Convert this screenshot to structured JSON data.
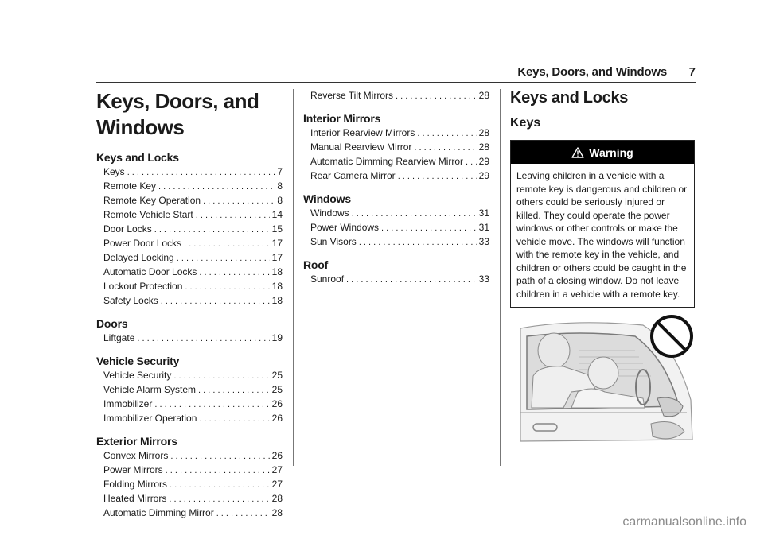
{
  "running_header": {
    "title": "Keys, Doors, and Windows",
    "page_number": "7"
  },
  "chapter": {
    "title_line1": "Keys, Doors, and",
    "title_line2": "Windows"
  },
  "toc_col1": [
    {
      "heading": "Keys and Locks",
      "items": [
        {
          "label": "Keys",
          "page": "7"
        },
        {
          "label": "Remote Key",
          "page": "8"
        },
        {
          "label": "Remote Key Operation",
          "page": "8"
        },
        {
          "label": "Remote Vehicle Start",
          "page": "14"
        },
        {
          "label": "Door Locks",
          "page": "15"
        },
        {
          "label": "Power Door Locks",
          "page": "17"
        },
        {
          "label": "Delayed Locking",
          "page": "17"
        },
        {
          "label": "Automatic Door Locks",
          "page": "18"
        },
        {
          "label": "Lockout Protection",
          "page": "18"
        },
        {
          "label": "Safety Locks",
          "page": "18"
        }
      ]
    },
    {
      "heading": "Doors",
      "items": [
        {
          "label": "Liftgate",
          "page": "19"
        }
      ]
    },
    {
      "heading": "Vehicle Security",
      "items": [
        {
          "label": "Vehicle Security",
          "page": "25"
        },
        {
          "label": "Vehicle Alarm System",
          "page": "25"
        },
        {
          "label": "Immobilizer",
          "page": "26"
        },
        {
          "label": "Immobilizer Operation",
          "page": "26"
        }
      ]
    },
    {
      "heading": "Exterior Mirrors",
      "items": [
        {
          "label": "Convex Mirrors",
          "page": "26"
        },
        {
          "label": "Power Mirrors",
          "page": "27"
        },
        {
          "label": "Folding Mirrors",
          "page": "27"
        },
        {
          "label": "Heated Mirrors",
          "page": "28"
        },
        {
          "label": "Automatic Dimming Mirror",
          "page": "28"
        }
      ]
    }
  ],
  "toc_col2_continued": [
    {
      "label": "Reverse Tilt Mirrors",
      "page": "28"
    }
  ],
  "toc_col2": [
    {
      "heading": "Interior Mirrors",
      "items": [
        {
          "label": "Interior Rearview Mirrors",
          "page": "28"
        },
        {
          "label": "Manual Rearview Mirror",
          "page": "28"
        },
        {
          "label": "Automatic Dimming Rearview Mirror",
          "page": "29"
        },
        {
          "label": "Rear Camera Mirror",
          "page": "29"
        }
      ]
    },
    {
      "heading": "Windows",
      "items": [
        {
          "label": "Windows",
          "page": "31"
        },
        {
          "label": "Power Windows",
          "page": "31"
        },
        {
          "label": "Sun Visors",
          "page": "33"
        }
      ]
    },
    {
      "heading": "Roof",
      "items": [
        {
          "label": "Sunroof",
          "page": "33"
        }
      ]
    }
  ],
  "body": {
    "section_title": "Keys and Locks",
    "subsection_title": "Keys",
    "warning": {
      "icon": "warning-triangle-icon",
      "label": "Warning",
      "text": "Leaving children in a vehicle with a remote key is dangerous and children or others could be seriously injured or killed. They could operate the power windows or other controls or make the vehicle move. The windows will function with the remote key in the vehicle, and children or others could be caught in the path of a closing window. Do not leave children in a vehicle with a remote key."
    },
    "illustration": {
      "description": "Children playing at the steering wheel inside a vehicle",
      "symbol": "prohibition-sign-icon"
    }
  },
  "watermark": "carmanualsonline.info"
}
